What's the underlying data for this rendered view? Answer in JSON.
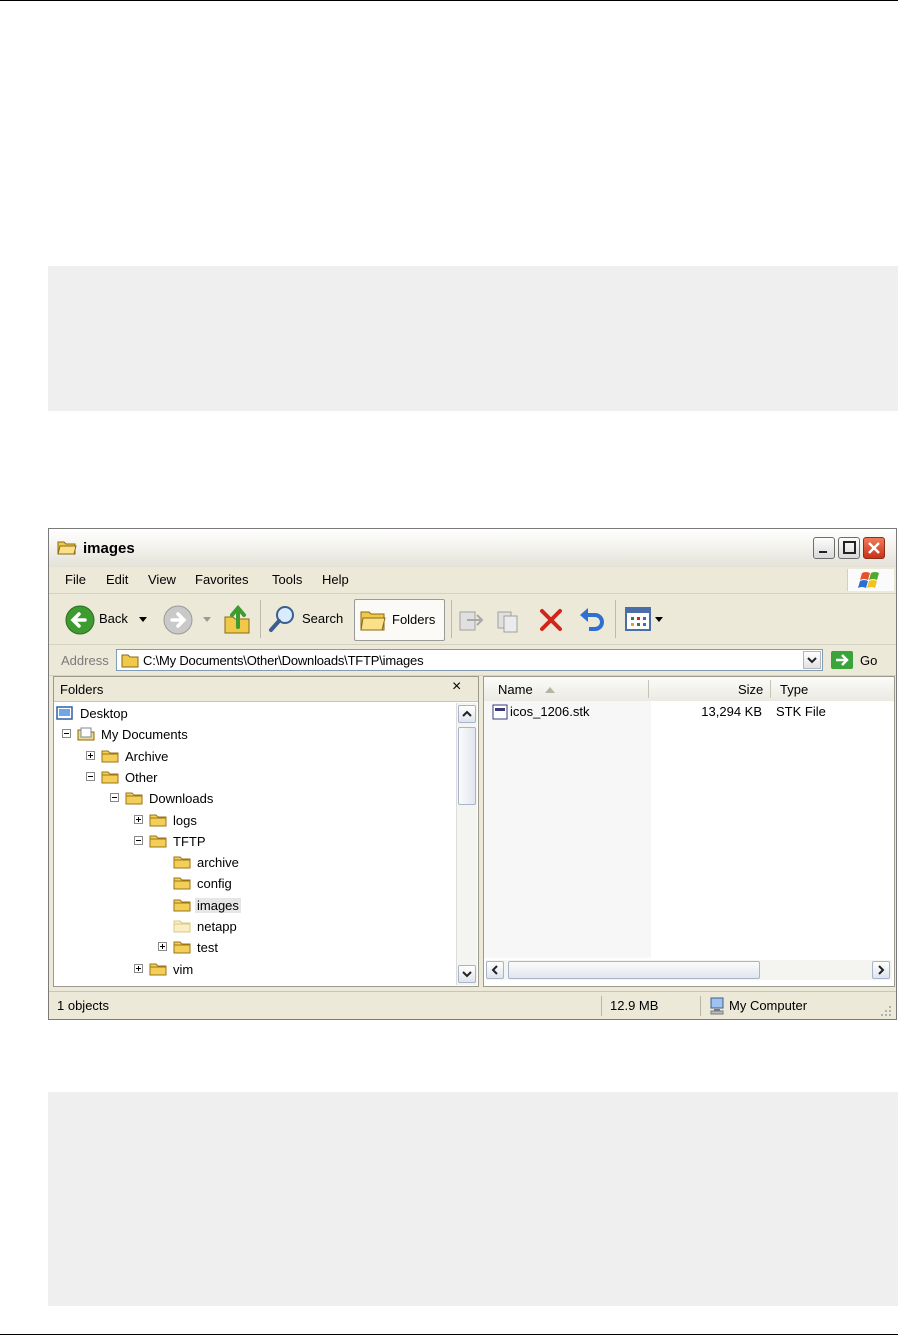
{
  "window": {
    "title": "images",
    "menu": [
      "File",
      "Edit",
      "View",
      "Favorites",
      "Tools",
      "Help"
    ],
    "toolbar": {
      "back": "Back",
      "search": "Search",
      "folders": "Folders"
    },
    "address": {
      "label": "Address",
      "value": "C:\\My Documents\\Other\\Downloads\\TFTP\\images",
      "go": "Go"
    },
    "folders_pane": {
      "title": "Folders",
      "close": "×",
      "tree": [
        {
          "label": "Desktop",
          "level": 0,
          "expander": "none",
          "icon": "desktop-icon"
        },
        {
          "label": "My Documents",
          "level": 1,
          "expander": "minus",
          "icon": "my-documents-icon"
        },
        {
          "label": "Archive",
          "level": 2,
          "expander": "plus",
          "icon": "folder-icon"
        },
        {
          "label": "Other",
          "level": 2,
          "expander": "minus",
          "icon": "folder-icon"
        },
        {
          "label": "Downloads",
          "level": 3,
          "expander": "minus",
          "icon": "folder-icon"
        },
        {
          "label": "logs",
          "level": 4,
          "expander": "plus",
          "icon": "folder-icon"
        },
        {
          "label": "TFTP",
          "level": 4,
          "expander": "minus",
          "icon": "folder-icon"
        },
        {
          "label": "archive",
          "level": 5,
          "expander": "none",
          "icon": "folder-icon"
        },
        {
          "label": "config",
          "level": 5,
          "expander": "none",
          "icon": "folder-icon"
        },
        {
          "label": "images",
          "level": 5,
          "expander": "none",
          "icon": "folder-icon",
          "selected": true
        },
        {
          "label": "netapp",
          "level": 5,
          "expander": "none",
          "icon": "folder-faded-icon"
        },
        {
          "label": "test",
          "level": 5,
          "expander": "plus",
          "icon": "folder-icon"
        },
        {
          "label": "vim",
          "level": 4,
          "expander": "plus",
          "icon": "folder-icon"
        }
      ]
    },
    "files": {
      "columns": {
        "name": "Name",
        "size": "Size",
        "type": "Type"
      },
      "rows": [
        {
          "name": "icos_1206.stk",
          "size": "13,294 KB",
          "type": "STK File"
        }
      ]
    },
    "status": {
      "objects": "1 objects",
      "size": "12.9 MB",
      "location": "My Computer"
    }
  }
}
